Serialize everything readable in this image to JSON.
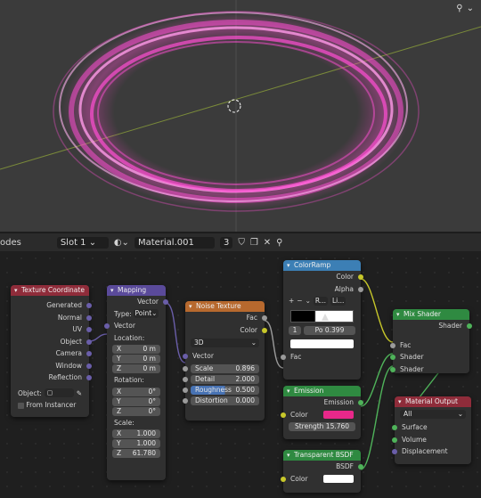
{
  "viewport": {
    "view_button": "⚲"
  },
  "header": {
    "editor_label": "odes",
    "slot": "Slot 1",
    "material": "Material.001",
    "user_count": "3"
  },
  "nodes": {
    "texcoord": {
      "title": "Texture Coordinate",
      "outputs": [
        "Generated",
        "Normal",
        "UV",
        "Object",
        "Camera",
        "Window",
        "Reflection"
      ],
      "object_label": "Object:",
      "from_instancer": "From Instancer"
    },
    "mapping": {
      "title": "Mapping",
      "vector_out": "Vector",
      "type_label": "Type:",
      "type_value": "Point",
      "vector_in": "Vector",
      "location_label": "Location:",
      "location": [
        [
          "X",
          "0 m"
        ],
        [
          "Y",
          "0 m"
        ],
        [
          "Z",
          "0 m"
        ]
      ],
      "rotation_label": "Rotation:",
      "rotation": [
        [
          "X",
          "0°"
        ],
        [
          "Y",
          "0°"
        ],
        [
          "Z",
          "0°"
        ]
      ],
      "scale_label": "Scale:",
      "scale": [
        [
          "X",
          "1.000"
        ],
        [
          "Y",
          "1.000"
        ],
        [
          "Z",
          "61.780"
        ]
      ]
    },
    "noise": {
      "title": "Noise Texture",
      "out_fac": "Fac",
      "out_color": "Color",
      "dim": "3D",
      "vector_in": "Vector",
      "fields": [
        [
          "Scale",
          "0.896"
        ],
        [
          "Detail",
          "2.000"
        ],
        [
          "Roughness",
          "0.500"
        ],
        [
          "Distortion",
          "0.000"
        ]
      ]
    },
    "colorramp": {
      "title": "ColorRamp",
      "out_color": "Color",
      "out_alpha": "Alpha",
      "controls": [
        "+",
        "−",
        "⌄",
        "R...",
        "Li..."
      ],
      "index": "1",
      "pos_label": "Po",
      "pos": "0.399",
      "in_fac": "Fac"
    },
    "emission": {
      "title": "Emission",
      "out": "Emission",
      "color_label": "Color",
      "strength_label": "Strength",
      "strength": "15.760",
      "color": "#e8288a"
    },
    "transparent": {
      "title": "Transparent BSDF",
      "out": "BSDF",
      "color_label": "Color"
    },
    "mixshader": {
      "title": "Mix Shader",
      "out": "Shader",
      "in": [
        "Fac",
        "Shader",
        "Shader"
      ]
    },
    "output": {
      "title": "Material Output",
      "target": "All",
      "in": [
        "Surface",
        "Volume",
        "Displacement"
      ]
    }
  },
  "colors": {
    "input_header": "#8f2c3a",
    "vector_header": "#5a4a9a",
    "texture_header": "#b7692e",
    "converter_header": "#3c7fb5",
    "shader_header": "#2f8a41",
    "output_header": "#8f2c3a"
  }
}
